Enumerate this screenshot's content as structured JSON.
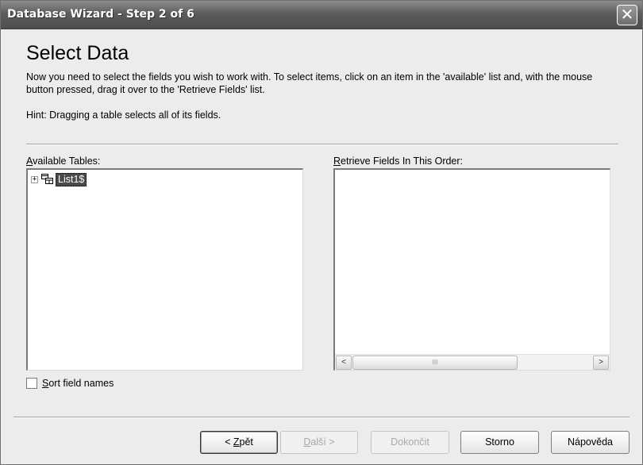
{
  "window": {
    "title": "Database Wizard - Step 2 of 6",
    "close_glyph": "✕"
  },
  "content": {
    "heading": "Select Data",
    "description": "Now you need to select the fields you wish to work with. To select items, click on an item in the 'available' list and, with the mouse button pressed, drag it over to the 'Retrieve Fields' list.",
    "hint": "Hint: Dragging a table selects all of its fields."
  },
  "available": {
    "label_accel": "A",
    "label_rest": "vailable Tables:",
    "expander": "+",
    "items": [
      {
        "label": "List1$",
        "icon": "table-icon"
      }
    ]
  },
  "retrieve": {
    "label_accel": "R",
    "label_rest": "etrieve Fields In This Order:",
    "scroll_left": "<",
    "scroll_right": ">",
    "scroll_grip": "III"
  },
  "sort": {
    "label_accel": "S",
    "label_rest": "ort field names",
    "checked": false
  },
  "buttons": {
    "back": {
      "prefix": "< ",
      "accel": "Z",
      "rest": "pět"
    },
    "next": {
      "accel": "D",
      "rest": "alší >"
    },
    "finish": "Dokončit",
    "cancel": "Storno",
    "help": "Nápověda"
  }
}
